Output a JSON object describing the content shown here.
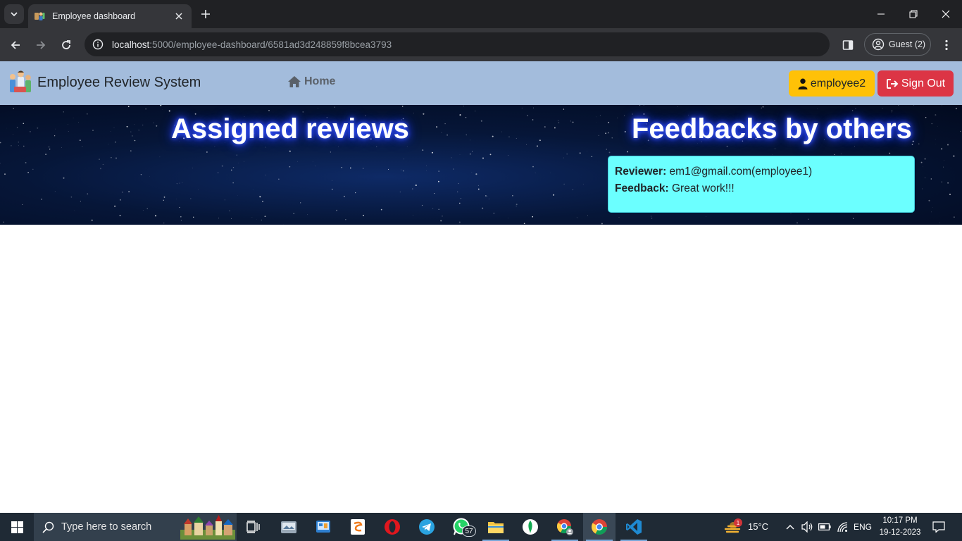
{
  "browser": {
    "tab": {
      "title": "Employee dashboard",
      "icon": "employee-favicon"
    },
    "url": {
      "host": "localhost",
      "rest": ":5000/employee-dashboard/6581ad3d248859f8bcea3793"
    },
    "profile": {
      "label": "Guest (2)"
    },
    "colors": {
      "frame": "#202124",
      "toolbar": "#35363a"
    }
  },
  "navbar": {
    "brand": "Employee Review System",
    "home": "Home",
    "user_button": "employee2",
    "signout_button": "Sign Out",
    "colors": {
      "background": "#a3bcdc",
      "user": "#ffc107",
      "signout": "#dc3545"
    }
  },
  "main": {
    "assigned_title": "Assigned reviews",
    "feedback_title": "Feedbacks by others",
    "feedbacks": [
      {
        "reviewer_label": "Reviewer:",
        "reviewer": "em1@gmail.com(employee1)",
        "feedback_label": "Feedback:",
        "feedback": "Great work!!!"
      }
    ],
    "colors": {
      "card": "#6bffff",
      "title_glow": "#2a46ff"
    }
  },
  "taskbar": {
    "search_placeholder": "Type here to search",
    "whatsapp_badge": "57",
    "weather_badge": "1",
    "temperature": "15°C",
    "language": "ENG",
    "time": "10:17 PM",
    "date": "19-12-2023"
  }
}
